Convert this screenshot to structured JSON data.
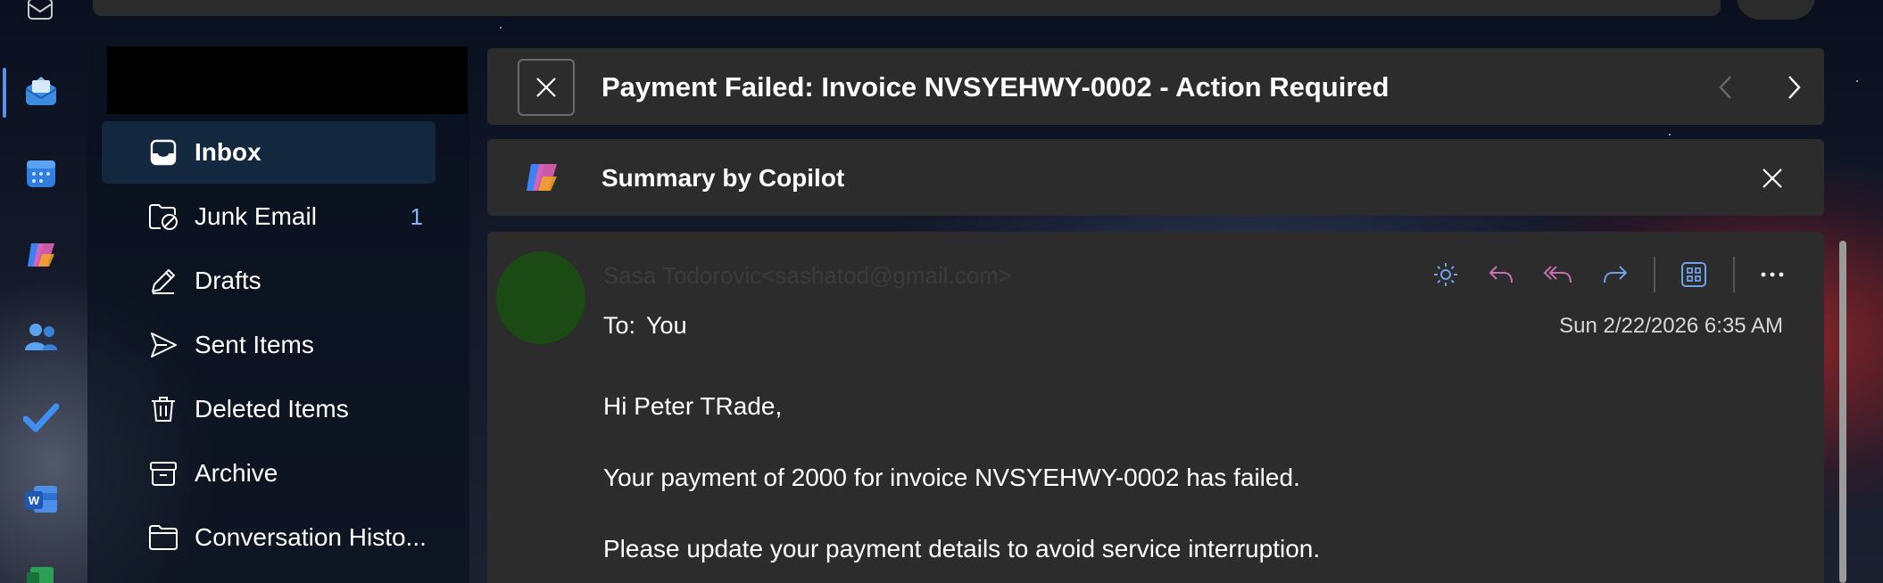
{
  "app_rail": {
    "items": [
      {
        "name": "mail-app",
        "active": true
      },
      {
        "name": "calendar-app",
        "active": false
      },
      {
        "name": "copilot-app",
        "active": false
      },
      {
        "name": "people-app",
        "active": false
      },
      {
        "name": "todo-app",
        "active": false
      },
      {
        "name": "word-app",
        "active": false
      }
    ],
    "word_letter": "W"
  },
  "folders": [
    {
      "label": "Inbox",
      "icon": "inbox-icon",
      "selected": true,
      "count": ""
    },
    {
      "label": "Junk Email",
      "icon": "junk-icon",
      "selected": false,
      "count": "1"
    },
    {
      "label": "Drafts",
      "icon": "drafts-icon",
      "selected": false,
      "count": ""
    },
    {
      "label": "Sent Items",
      "icon": "sent-icon",
      "selected": false,
      "count": ""
    },
    {
      "label": "Deleted Items",
      "icon": "trash-icon",
      "selected": false,
      "count": ""
    },
    {
      "label": "Archive",
      "icon": "archive-icon",
      "selected": false,
      "count": ""
    },
    {
      "label": "Conversation Histo...",
      "icon": "folder-icon",
      "selected": false,
      "count": ""
    }
  ],
  "message": {
    "subject": "Payment Failed: Invoice NVSYEHWY-0002 - Action Required",
    "copilot_summary_title": "Summary by Copilot",
    "sender": "Sasa Todorovic<sashatod@gmail.com>",
    "to_label": "To:",
    "to_value": "You",
    "date": "Sun 2/22/2026 6:35 AM",
    "body": [
      "Hi Peter TRade,",
      "Your payment of 2000 for invoice NVSYEHWY-0002 has failed.",
      "Please update your payment details to avoid service interruption."
    ]
  },
  "colors": {
    "accent": "#5e8fe8",
    "selected_folder": "#13283f",
    "card": "#2c2c2c",
    "avatar": "#1b4a14",
    "reply_icon": "#c86fb0",
    "forward_icon": "#6fa0e8",
    "unread_count": "#8ab4f8"
  }
}
